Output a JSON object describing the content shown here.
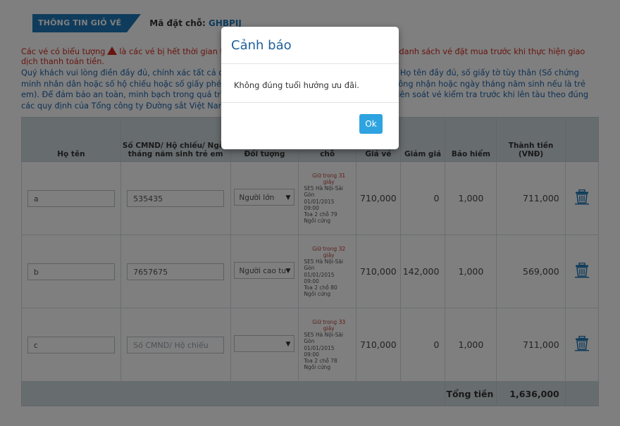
{
  "header": {
    "tab_label": "THÔNG TIN GIỎ VÉ",
    "booking_label": "Mã đặt chỗ:",
    "booking_code": "GHBPIJ"
  },
  "warning": {
    "part1": "Các vé có biểu tượng",
    "part2": "là các vé bị hết thời gian tạm giữ. Xin vui lòng loại bỏ các vé này khỏi danh sách vé đặt mua trước khi thực hiện giao dịch thanh toán tiền."
  },
  "info_text": "Quý khách vui lòng điền đầy đủ, chính xác tất cả các thông tin về hành khách đi tàu bao gồm: Họ tên đầy đủ, số giấy tờ tùy thân (Số chứng minh nhân dân hoặc số hộ chiếu hoặc số giấy phép lái xe đường bộ được pháp luật Việt Nam công nhận hoặc ngày tháng năm sinh nếu là trẻ em). Để đảm bảo an toàn, minh bạch trong quá trình bán vé các thông tin này sẽ được nhân viên soát vé kiểm tra trước khi lên tàu theo đúng các quy định của Tổng công ty Đường sắt Việt Nam.",
  "table": {
    "headers": {
      "name": "Họ tên",
      "id": "Số CMND/ Hộ chiếu/ Ngày tháng năm sinh trẻ em",
      "type": "Đối tượng",
      "seat": "Thông tin chỗ",
      "price": "Giá vé",
      "discount": "Giảm giá",
      "insurance": "Bảo hiểm",
      "total": "Thành tiền (VNĐ)"
    },
    "rows": [
      {
        "name": "a",
        "id_value": "535435",
        "type": "Người lớn",
        "hold_prefix": "Giữ trong",
        "hold_seconds": "31",
        "hold_unit": "giây",
        "train": "SE5 Hà Nội-Sài Gòn",
        "date": "01/01/2015",
        "time": "09:00",
        "car_seat": "Toa 2 chỗ 79",
        "seat_type": "Ngồi cứng",
        "price": "710,000",
        "discount": "0",
        "insurance": "1,000",
        "total": "711,000"
      },
      {
        "name": "b",
        "id_value": "7657675",
        "type": "Người cao tu",
        "hold_prefix": "Giữ trong",
        "hold_seconds": "32",
        "hold_unit": "giây",
        "train": "SE5 Hà Nội-Sài Gòn",
        "date": "01/01/2015",
        "time": "09:00",
        "car_seat": "Toa 2 chỗ 80",
        "seat_type": "Ngồi cứng",
        "price": "710,000",
        "discount": "142,000",
        "insurance": "1,000",
        "total": "569,000"
      },
      {
        "name": "c",
        "id_placeholder": "Số CMND/ Hộ chiếu",
        "type": "",
        "hold_prefix": "Giữ trong",
        "hold_seconds": "33",
        "hold_unit": "giây",
        "train": "SE5 Hà Nội-Sài Gòn",
        "date": "01/01/2015",
        "time": "09:00",
        "car_seat": "Toa 2 chỗ 78",
        "seat_type": "Ngồi cứng",
        "price": "710,000",
        "discount": "0",
        "insurance": "1,000",
        "total": "711,000"
      }
    ],
    "footer": {
      "label": "Tổng tiền",
      "value": "1,636,000"
    }
  },
  "modal": {
    "title": "Cảnh báo",
    "message": "Không đúng tuổi hưởng ưu đãi.",
    "ok_label": "Ok"
  },
  "icons": {
    "warning": "warning-triangle-icon",
    "delete": "trash-icon",
    "select": "chevron-down-icon"
  },
  "colors": {
    "brand_blue": "#1e78b8",
    "warning_red": "#d12a1f",
    "ok_button": "#2ea3e0"
  }
}
